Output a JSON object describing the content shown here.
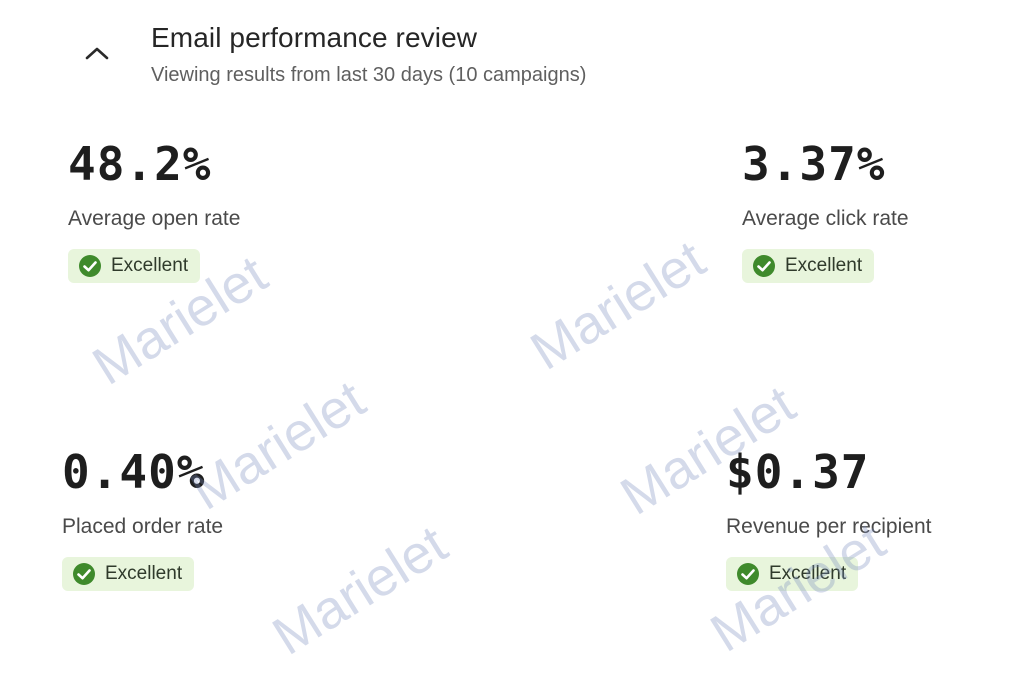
{
  "header": {
    "title": "Email performance review",
    "subtitle": "Viewing results from last 30 days (10 campaigns)",
    "toggle_icon": "chevron-up-icon"
  },
  "metrics": [
    {
      "value": "48.2%",
      "label": "Average open rate",
      "badge": "Excellent"
    },
    {
      "value": "3.37%",
      "label": "Average click rate",
      "badge": "Excellent"
    },
    {
      "value": "0.40%",
      "label": "Placed order rate",
      "badge": "Excellent"
    },
    {
      "value": "$0.37",
      "label": "Revenue per recipient",
      "badge": "Excellent"
    }
  ],
  "badge_icon": "check-circle-icon",
  "watermark": "Marielet",
  "colors": {
    "badge_bg": "#e8f5dc",
    "badge_icon": "#3f8a2c",
    "text_primary": "#1e1e1e",
    "text_secondary": "#5f5f5f"
  }
}
